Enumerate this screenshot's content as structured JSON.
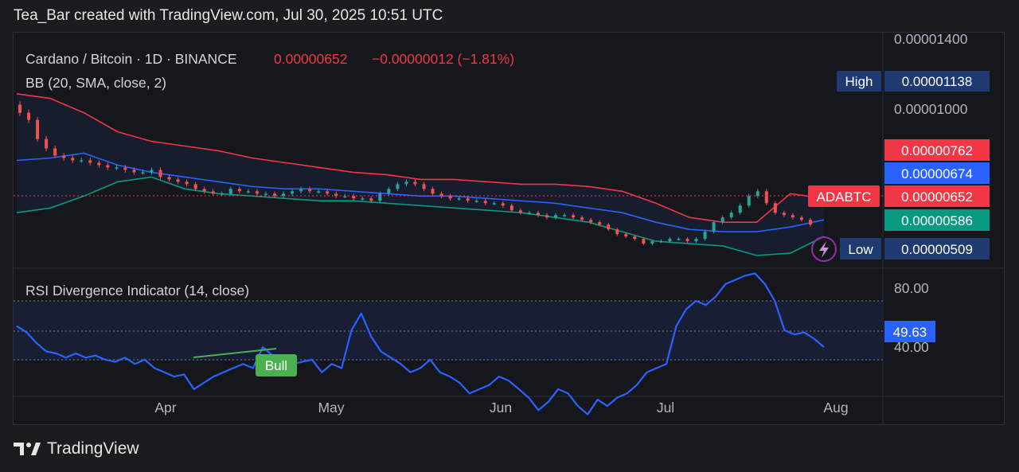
{
  "header": {
    "attribution": "Tea_Bar created with TradingView.com, Jul 30, 2025 10:51 UTC"
  },
  "legend": {
    "symbol": "Cardano / Bitcoin · 1D · BINANCE",
    "price": "0.00000652",
    "change": "−0.00000012 (−1.81%)",
    "indicator": "BB (20, SMA, close, 2)"
  },
  "rsi_legend": "RSI Divergence Indicator (14, close)",
  "badges": {
    "high_label": "High",
    "high_value": "0.00001138",
    "upper_value": "0.00000762",
    "mid_value": "0.00000674",
    "ticker": "ADABTC",
    "last_value": "0.00000652",
    "lower_value": "0.00000586",
    "low_label": "Low",
    "low_value": "0.00000509",
    "rsi_value": "49.63",
    "bull_label": "Bull"
  },
  "footer": {
    "brand": "TradingView"
  },
  "colors": {
    "up": "#26a69a",
    "down": "#ef5350",
    "upper_band": "#f23645",
    "basis": "#2962ff",
    "lower_band": "#089981",
    "rsi": "#2962ff",
    "bull": "#4caf50"
  },
  "chart_data": [
    {
      "type": "candlestick",
      "title": "Cardano / Bitcoin · 1D · BINANCE",
      "xlabel": "",
      "ylabel": "",
      "x_ticks": [
        "Apr",
        "May",
        "Jun",
        "Jul",
        "Aug"
      ],
      "y_ticks": [
        "0.00001400",
        "0.00001000"
      ],
      "ylim": [
        4.8e-06,
        1.43e-05
      ],
      "grid": false,
      "series": [
        {
          "name": "ADABTC",
          "close_values": [
            1.12e-05,
            1.09e-05,
            1.01e-05,
            9.7e-06,
            9.4e-06,
            9.3e-06,
            9.2e-06,
            9.2e-06,
            9.1e-06,
            9e-06,
            8.9e-06,
            8.9e-06,
            8.8e-06,
            8.7e-06,
            8.7e-06,
            8.8e-06,
            8.5e-06,
            8.4e-06,
            8.3e-06,
            8.2e-06,
            8e-06,
            7.9e-06,
            7.8e-06,
            7.8e-06,
            8e-06,
            7.9e-06,
            7.9e-06,
            7.8e-06,
            7.8e-06,
            7.7e-06,
            7.8e-06,
            7.9e-06,
            8e-06,
            7.9e-06,
            7.9e-06,
            7.8e-06,
            7.7e-06,
            7.7e-06,
            7.6e-06,
            7.6e-06,
            7.5e-06,
            7.8e-06,
            8e-06,
            8.2e-06,
            8.3e-06,
            8.2e-06,
            8e-06,
            7.8e-06,
            7.7e-06,
            7.6e-06,
            7.6e-06,
            7.5e-06,
            7.5e-06,
            7.4e-06,
            7.4e-06,
            7.3e-06,
            7.1e-06,
            7e-06,
            7e-06,
            6.9e-06,
            6.8e-06,
            6.9e-06,
            6.9e-06,
            6.8e-06,
            6.7e-06,
            6.6e-06,
            6.5e-06,
            6.3e-06,
            6.1e-06,
            6e-06,
            5.9e-06,
            5.7e-06,
            5.8e-06,
            5.8e-06,
            5.9e-06,
            5.9e-06,
            5.8e-06,
            5.9e-06,
            6.2e-06,
            6.6e-06,
            6.8e-06,
            7e-06,
            7.3e-06,
            7.7e-06,
            7.9e-06,
            7.4e-06,
            7e-06,
            6.9e-06,
            6.8e-06,
            6.7e-06,
            6.5e-06
          ]
        }
      ],
      "bands": {
        "upper": [
          1.2e-05,
          1.18e-05,
          1.12e-05,
          1.04e-05,
          1e-05,
          9.8e-06,
          9.6e-06,
          9.3e-06,
          9.1e-06,
          8.9e-06,
          8.7e-06,
          8.6e-06,
          8.4e-06,
          8.4e-06,
          8.3e-06,
          8.2e-06,
          8.2e-06,
          8.1e-06,
          7.9e-06,
          7.4e-06,
          6.8e-06,
          6.6e-06,
          6.6e-06,
          7.8e-06,
          7.6e-06
        ],
        "basis": [
          9.2e-06,
          9.3e-06,
          9.5e-06,
          9e-06,
          8.7e-06,
          8.5e-06,
          8.3e-06,
          8.1e-06,
          8e-06,
          8e-06,
          7.9e-06,
          7.8e-06,
          7.7e-06,
          7.7e-06,
          7.6e-06,
          7.5e-06,
          7.4e-06,
          7.2e-06,
          7e-06,
          6.6e-06,
          6.3e-06,
          6.2e-06,
          6.2e-06,
          6.4e-06,
          6.7e-06
        ],
        "lower": [
          7e-06,
          7.2e-06,
          7.7e-06,
          8.3e-06,
          8.5e-06,
          8e-06,
          7.8e-06,
          7.7e-06,
          7.6e-06,
          7.5e-06,
          7.5e-06,
          7.4e-06,
          7.3e-06,
          7.2e-06,
          7.1e-06,
          7e-06,
          6.8e-06,
          6.6e-06,
          6.2e-06,
          5.8e-06,
          5.7e-06,
          5.6e-06,
          5.2e-06,
          5.3e-06,
          6e-06
        ]
      }
    },
    {
      "type": "line",
      "title": "RSI Divergence Indicator (14, close)",
      "xlabel": "",
      "ylabel": "",
      "y_ticks": [
        "80.00",
        "40.00"
      ],
      "ylim": [
        33,
        86
      ],
      "bands": [
        30,
        70
      ],
      "midline": 50,
      "series": [
        {
          "name": "RSI",
          "values": [
            60,
            57,
            52,
            48,
            47,
            45,
            47,
            45,
            46,
            44,
            43,
            45,
            42,
            44,
            40,
            38,
            36,
            37,
            30,
            33,
            36,
            38,
            40,
            42,
            40,
            50,
            46,
            45,
            42,
            43,
            44,
            38,
            42,
            40,
            58,
            66,
            55,
            48,
            45,
            42,
            38,
            40,
            44,
            38,
            36,
            33,
            28,
            30,
            32,
            36,
            34,
            30,
            26,
            20,
            24,
            30,
            28,
            22,
            18,
            25,
            22,
            26,
            28,
            32,
            38,
            40,
            42,
            60,
            68,
            72,
            70,
            74,
            80,
            82,
            84,
            85,
            80,
            72,
            58,
            56,
            57,
            54,
            50
          ]
        }
      ],
      "annotations": [
        "Bull"
      ]
    }
  ]
}
